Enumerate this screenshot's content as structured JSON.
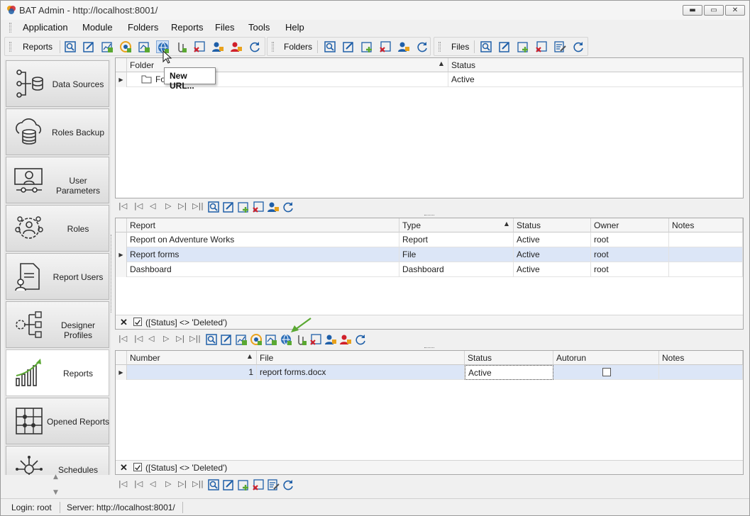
{
  "window": {
    "title": "BAT Admin - http://localhost:8001/"
  },
  "menu": [
    "Application",
    "Module",
    "Folders",
    "Reports",
    "Files",
    "Tools",
    "Help"
  ],
  "toolbar": {
    "reports_label": "Reports",
    "folders_label": "Folders",
    "files_label": "Files",
    "tooltip": "New URL..."
  },
  "nav": {
    "items": [
      {
        "label": "Data Sources",
        "icon": "data-sources-icon"
      },
      {
        "label": "Roles Backup",
        "icon": "cloud-database-icon"
      },
      {
        "label": "User Parameters",
        "icon": "user-parameters-icon"
      },
      {
        "label": "Roles",
        "icon": "roles-icon"
      },
      {
        "label": "Report Users",
        "icon": "report-users-icon"
      },
      {
        "label": "Designer Profiles",
        "icon": "designer-profiles-icon"
      },
      {
        "label": "Reports",
        "icon": "reports-chart-icon"
      },
      {
        "label": "Opened Reports",
        "icon": "opened-reports-icon"
      },
      {
        "label": "Schedules",
        "icon": "schedules-icon"
      }
    ]
  },
  "folders_grid": {
    "columns": [
      "Folder",
      "Status"
    ],
    "rows": [
      {
        "folder": "Fo",
        "status": "Active"
      }
    ]
  },
  "reports_grid": {
    "columns": [
      "Report",
      "Type",
      "Status",
      "Owner",
      "Notes"
    ],
    "rows": [
      {
        "report": "Report on Adventure Works",
        "type": "Report",
        "status": "Active",
        "owner": "root",
        "notes": ""
      },
      {
        "report": "Report forms",
        "type": "File",
        "status": "Active",
        "owner": "root",
        "notes": ""
      },
      {
        "report": "Dashboard",
        "type": "Dashboard",
        "status": "Active",
        "owner": "root",
        "notes": ""
      }
    ],
    "filter": "([Status] <> 'Deleted')"
  },
  "files_grid": {
    "columns": [
      "Number",
      "File",
      "Status",
      "Autorun",
      "Notes"
    ],
    "rows": [
      {
        "number": "1",
        "file": "report forms.docx",
        "status": "Active",
        "autorun": false,
        "notes": ""
      }
    ],
    "filter": "([Status] <> 'Deleted')"
  },
  "status": {
    "login": "Login: root",
    "server": "Server: http://localhost:8001/"
  },
  "colors": {
    "selected_row": "#dce6f7",
    "accent_green": "#5aa832",
    "icon_blue": "#1f5fa8",
    "delete_red": "#d0202a"
  }
}
